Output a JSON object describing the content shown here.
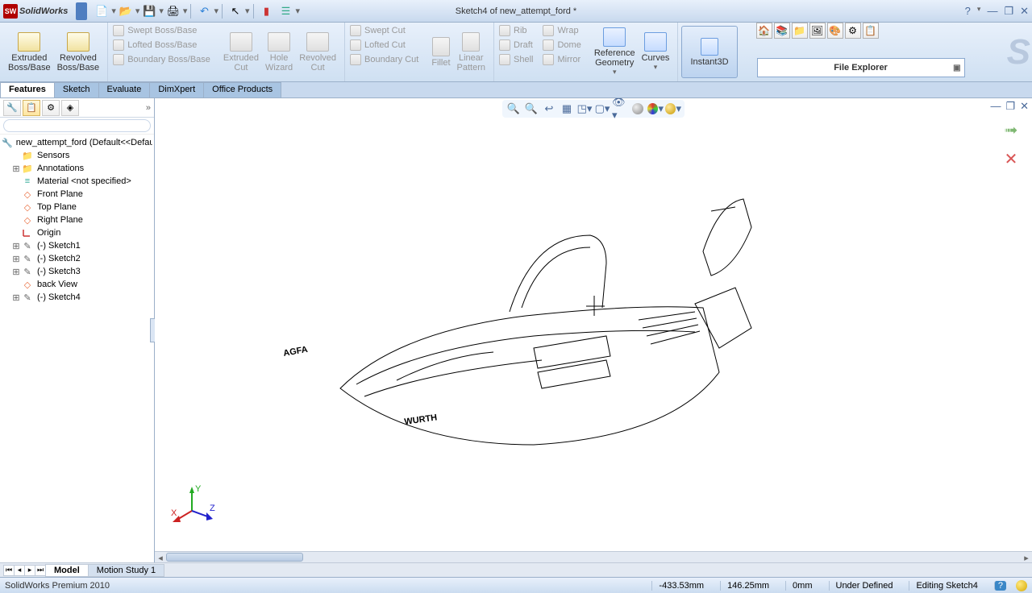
{
  "title": "Sketch4 of new_attempt_ford *",
  "brand": "SolidWorks",
  "ribbon": {
    "extruded_boss": "Extruded\nBoss/Base",
    "revolved_boss": "Revolved\nBoss/Base",
    "swept_boss": "Swept Boss/Base",
    "lofted_boss": "Lofted Boss/Base",
    "boundary_boss": "Boundary Boss/Base",
    "extruded_cut": "Extruded\nCut",
    "hole_wizard": "Hole\nWizard",
    "revolved_cut": "Revolved\nCut",
    "swept_cut": "Swept Cut",
    "lofted_cut": "Lofted Cut",
    "boundary_cut": "Boundary Cut",
    "fillet": "Fillet",
    "linear_pattern": "Linear\nPattern",
    "rib": "Rib",
    "draft": "Draft",
    "shell": "Shell",
    "wrap": "Wrap",
    "dome": "Dome",
    "mirror": "Mirror",
    "ref_geom": "Reference\nGeometry",
    "curves": "Curves",
    "instant3d": "Instant3D"
  },
  "file_explorer": "File Explorer",
  "tabs": {
    "features": "Features",
    "sketch": "Sketch",
    "evaluate": "Evaluate",
    "dimxpert": "DimXpert",
    "office": "Office Products"
  },
  "tree": {
    "root": "new_attempt_ford  (Default<<Defau",
    "sensors": "Sensors",
    "annotations": "Annotations",
    "material": "Material <not specified>",
    "front_plane": "Front Plane",
    "top_plane": "Top Plane",
    "right_plane": "Right Plane",
    "origin": "Origin",
    "sketch1": "(-) Sketch1",
    "sketch2": "(-) Sketch2",
    "sketch3": "(-) Sketch3",
    "back_view": "back View",
    "sketch4": "(-) Sketch4"
  },
  "bottom_tabs": {
    "model": "Model",
    "motion": "Motion Study 1"
  },
  "status": {
    "product": "SolidWorks Premium 2010",
    "x": "-433.53mm",
    "y": "146.25mm",
    "z": "0mm",
    "defined": "Under Defined",
    "editing": "Editing Sketch4",
    "help": "?"
  }
}
